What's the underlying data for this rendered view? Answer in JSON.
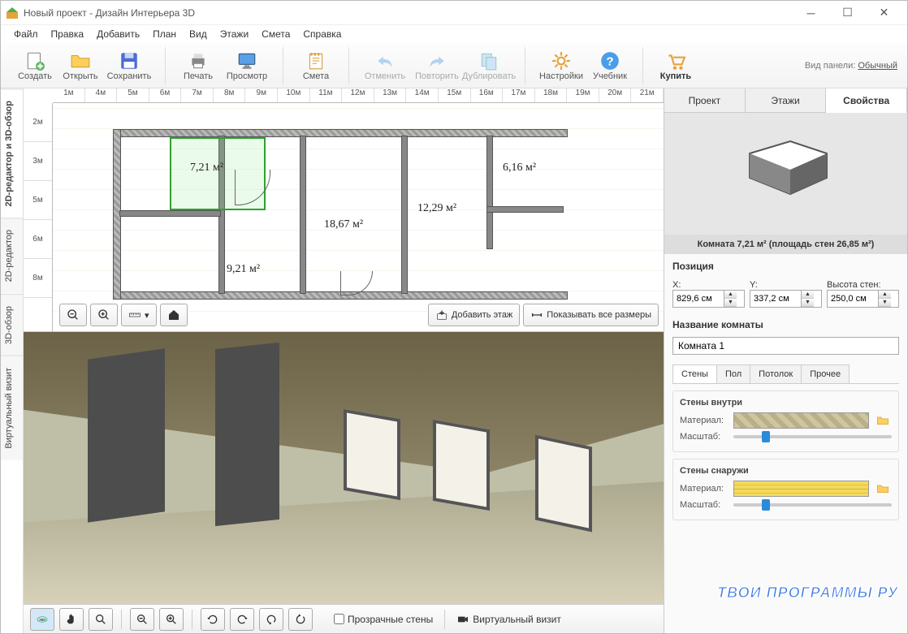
{
  "window": {
    "title": "Новый проект - Дизайн Интерьера 3D"
  },
  "menu": [
    "Файл",
    "Правка",
    "Добавить",
    "План",
    "Вид",
    "Этажи",
    "Смета",
    "Справка"
  ],
  "toolbar": {
    "create": "Создать",
    "open": "Открыть",
    "save": "Сохранить",
    "print": "Печать",
    "preview": "Просмотр",
    "estimate": "Смета",
    "undo": "Отменить",
    "redo": "Повторить",
    "duplicate": "Дублировать",
    "settings": "Настройки",
    "tutorial": "Учебник",
    "buy": "Купить",
    "panel_label": "Вид панели:",
    "panel_link": "Обычный"
  },
  "leftTabs": [
    "2D-редактор и 3D-обзор",
    "2D-редактор",
    "3D-обзор",
    "Виртуальный визит"
  ],
  "rulerH": [
    "1м",
    "4м",
    "5м",
    "6м",
    "7м",
    "8м",
    "9м",
    "10м",
    "11м",
    "12м",
    "13м",
    "14м",
    "15м",
    "16м",
    "17м",
    "18м",
    "19м",
    "20м",
    "21м"
  ],
  "rulerV": [
    "2м",
    "3м",
    "5м",
    "6м",
    "8м"
  ],
  "rooms": {
    "r1": "7,21 м²",
    "r2": "6,16 м²",
    "r3": "18,67 м²",
    "r4": "12,29 м²",
    "r5": "9,21 м²"
  },
  "planBtns": {
    "addFloor": "Добавить этаж",
    "showDims": "Показывать все размеры"
  },
  "bottom": {
    "transparent": "Прозрачные стены",
    "virtual": "Виртуальный визит"
  },
  "right": {
    "tabs": [
      "Проект",
      "Этажи",
      "Свойства"
    ],
    "caption": "Комната 7,21 м²  (площадь стен 26,85 м²)",
    "section_pos": "Позиция",
    "x": "X:",
    "y": "Y:",
    "wallH": "Высота стен:",
    "xval": "829,6 см",
    "yval": "337,2 см",
    "hval": "250,0 см",
    "section_name": "Название комнаты",
    "room_name": "Комната 1",
    "subtabs": [
      "Стены",
      "Пол",
      "Потолок",
      "Прочее"
    ],
    "walls_in": "Стены внутри",
    "walls_out": "Стены снаружи",
    "material": "Материал:",
    "scale": "Масштаб:"
  },
  "watermark": "ТВОИ ПРОГРАММЫ РУ"
}
